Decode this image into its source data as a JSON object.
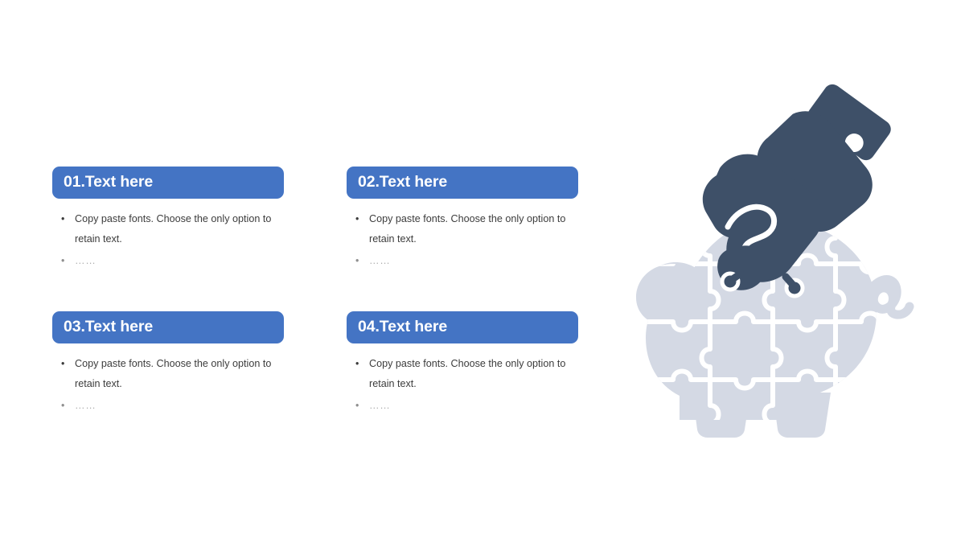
{
  "slide": {
    "background_color": "#ffffff",
    "accent_color": "#4474c4",
    "illustration_dark_color": "#3e5068",
    "illustration_light_color": "#d4d9e4"
  },
  "blocks": [
    {
      "header": "01.Text here",
      "bullets": [
        "Copy paste fonts. Choose the only option to retain text.",
        "……"
      ]
    },
    {
      "header": "02.Text here",
      "bullets": [
        "Copy paste fonts. Choose the only option to retain text.",
        "……"
      ]
    },
    {
      "header": "03.Text here",
      "bullets": [
        "Copy paste fonts. Choose the only option to retain text.",
        "……"
      ]
    },
    {
      "header": "04.Text here",
      "bullets": [
        "Copy paste fonts. Choose the only option to retain text.",
        "……"
      ]
    }
  ],
  "illustration": {
    "name": "piggy-bank-puzzle-with-hand-inserting-coin",
    "parts": {
      "piggy_bank": "piggy-bank",
      "puzzle_pieces": "puzzle-pieces",
      "hand": "hand",
      "coin": "coin"
    }
  }
}
